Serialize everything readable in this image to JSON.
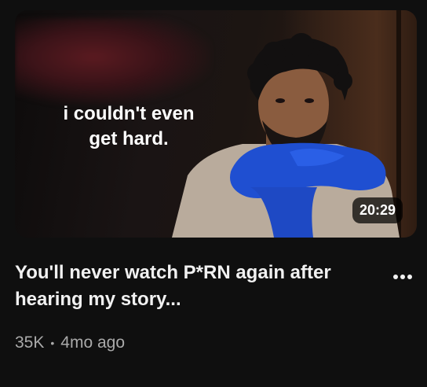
{
  "video": {
    "thumbnail_caption_line1": "i couldn't even",
    "thumbnail_caption_line2": "get hard.",
    "duration": "20:29",
    "title": "You'll never watch P*RN again after hearing my story...",
    "views": "35K",
    "separator": "•",
    "age": "4mo ago"
  },
  "icons": {
    "menu": "more-vert-icon"
  },
  "colors": {
    "background": "#0f0f0f",
    "title": "#f1f1f1",
    "meta": "#aaaaaa",
    "scarf": "#1f4fd1"
  }
}
